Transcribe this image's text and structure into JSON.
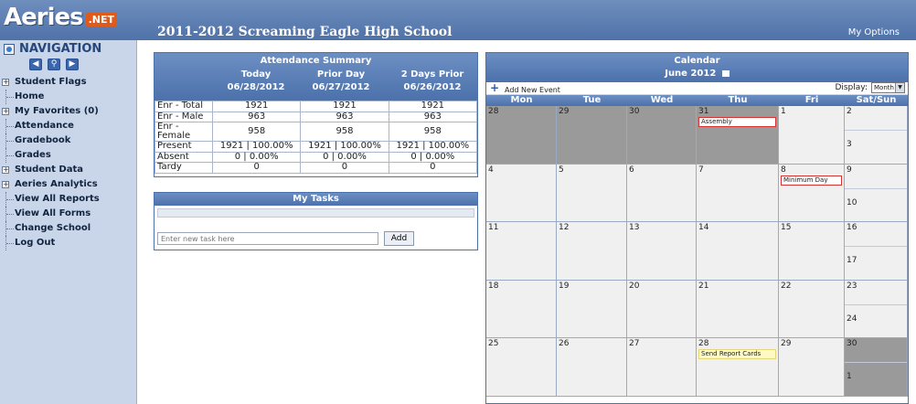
{
  "app": {
    "logo_text": "Aeries",
    "logo_badge": ".NET",
    "school_title": "2011-2012 Screaming Eagle High School",
    "my_options": "My Options"
  },
  "nav": {
    "heading": "NAVIGATION",
    "items": [
      {
        "label": "Student Flags",
        "expandable": true
      },
      {
        "label": "Home",
        "expandable": false
      },
      {
        "label": "My Favorites (0)",
        "expandable": true
      },
      {
        "label": "Attendance",
        "expandable": false
      },
      {
        "label": "Gradebook",
        "expandable": false
      },
      {
        "label": "Grades",
        "expandable": false
      },
      {
        "label": "Student Data",
        "expandable": true
      },
      {
        "label": "Aeries Analytics",
        "expandable": true
      },
      {
        "label": "View All Reports",
        "expandable": false
      },
      {
        "label": "View All Forms",
        "expandable": false
      },
      {
        "label": "Change School",
        "expandable": false
      },
      {
        "label": "Log Out",
        "expandable": false
      }
    ]
  },
  "attendance": {
    "title": "Attendance Summary",
    "columns": [
      {
        "label": "Today",
        "date": "06/28/2012"
      },
      {
        "label": "Prior Day",
        "date": "06/27/2012"
      },
      {
        "label": "2 Days Prior",
        "date": "06/26/2012"
      }
    ],
    "rows": [
      {
        "label": "Enr - Total",
        "values": [
          "1921",
          "1921",
          "1921"
        ]
      },
      {
        "label": "Enr - Male",
        "values": [
          "963",
          "963",
          "963"
        ]
      },
      {
        "label": "Enr - Female",
        "values": [
          "958",
          "958",
          "958"
        ]
      },
      {
        "label": "Present",
        "values": [
          "1921 | 100.00%",
          "1921 | 100.00%",
          "1921 | 100.00%"
        ]
      },
      {
        "label": "Absent",
        "values": [
          "0 | 0.00%",
          "0 | 0.00%",
          "0 | 0.00%"
        ]
      },
      {
        "label": "Tardy",
        "values": [
          "0",
          "0",
          "0"
        ]
      }
    ]
  },
  "tasks": {
    "title": "My Tasks",
    "input_placeholder": "Enter new task here",
    "add_label": "Add"
  },
  "calendar": {
    "title": "Calendar",
    "month": "June 2012",
    "add_event": "Add New Event",
    "display_label": "Display:",
    "display_value": "Month",
    "weekdays": [
      "Mon",
      "Tue",
      "Wed",
      "Thu",
      "Fri",
      "Sat/Sun"
    ],
    "weeks": [
      {
        "days": [
          {
            "num": "28",
            "gray": true
          },
          {
            "num": "29",
            "gray": true
          },
          {
            "num": "30",
            "gray": true
          },
          {
            "num": "31",
            "gray": true,
            "event": "Assembly",
            "event_style": "red"
          },
          {
            "num": "1"
          }
        ],
        "weekend": [
          {
            "num": "2"
          },
          {
            "num": "3"
          }
        ]
      },
      {
        "days": [
          {
            "num": "4"
          },
          {
            "num": "5"
          },
          {
            "num": "6"
          },
          {
            "num": "7"
          },
          {
            "num": "8",
            "event": "Minimum Day",
            "event_style": "red"
          }
        ],
        "weekend": [
          {
            "num": "9"
          },
          {
            "num": "10"
          }
        ]
      },
      {
        "days": [
          {
            "num": "11"
          },
          {
            "num": "12"
          },
          {
            "num": "13"
          },
          {
            "num": "14"
          },
          {
            "num": "15"
          }
        ],
        "weekend": [
          {
            "num": "16"
          },
          {
            "num": "17"
          }
        ]
      },
      {
        "days": [
          {
            "num": "18"
          },
          {
            "num": "19"
          },
          {
            "num": "20"
          },
          {
            "num": "21"
          },
          {
            "num": "22"
          }
        ],
        "weekend": [
          {
            "num": "23"
          },
          {
            "num": "24"
          }
        ]
      },
      {
        "days": [
          {
            "num": "25"
          },
          {
            "num": "26"
          },
          {
            "num": "27"
          },
          {
            "num": "28",
            "event": "Send Report Cards",
            "event_style": "yellow"
          },
          {
            "num": "29"
          }
        ],
        "weekend": [
          {
            "num": "30",
            "gray": true
          },
          {
            "num": "1",
            "gray": true
          }
        ]
      }
    ]
  },
  "colors": {
    "header_blue": "#4f72a8",
    "nav_bg": "#c9d6ea",
    "cell_bg": "#f0f0f0",
    "gray_cell": "#9a9a9a",
    "event_red": "#d23434",
    "event_yellow": "#fff9c4"
  }
}
